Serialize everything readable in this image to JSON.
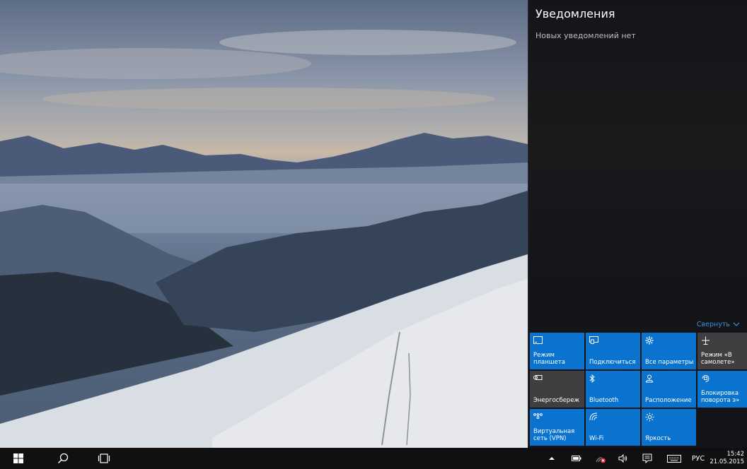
{
  "action_center": {
    "title": "Уведомления",
    "empty_message": "Новых уведомлений нет",
    "collapse_label": "Свернуть",
    "tiles": [
      {
        "label": "Режим планшета",
        "icon": "tablet-mode-icon",
        "state": "on"
      },
      {
        "label": "Подключиться",
        "icon": "connect-icon",
        "state": "on"
      },
      {
        "label": "Все параметры",
        "icon": "settings-gear-icon",
        "state": "on"
      },
      {
        "label": "Режим «В самолете»",
        "icon": "airplane-icon",
        "state": "off"
      },
      {
        "label": "Энергосбереж",
        "icon": "battery-saver-icon",
        "state": "off"
      },
      {
        "label": "Bluetooth",
        "icon": "bluetooth-icon",
        "state": "on"
      },
      {
        "label": "Расположение",
        "icon": "location-icon",
        "state": "on"
      },
      {
        "label": "Блокировка поворота э»",
        "icon": "rotation-lock-icon",
        "state": "on"
      },
      {
        "label": "Виртуальная сеть (VPN)",
        "icon": "vpn-icon",
        "state": "on"
      },
      {
        "label": "Wi-Fi",
        "icon": "wifi-icon",
        "state": "on"
      },
      {
        "label": "Яркость",
        "icon": "brightness-icon",
        "state": "on"
      }
    ]
  },
  "taskbar": {
    "language": "РУС",
    "time": "15:42",
    "date": "21.05.2015"
  },
  "colors": {
    "accent": "#0a73d0",
    "tile_off": "#3f3f41",
    "link": "#3f8fd9"
  }
}
